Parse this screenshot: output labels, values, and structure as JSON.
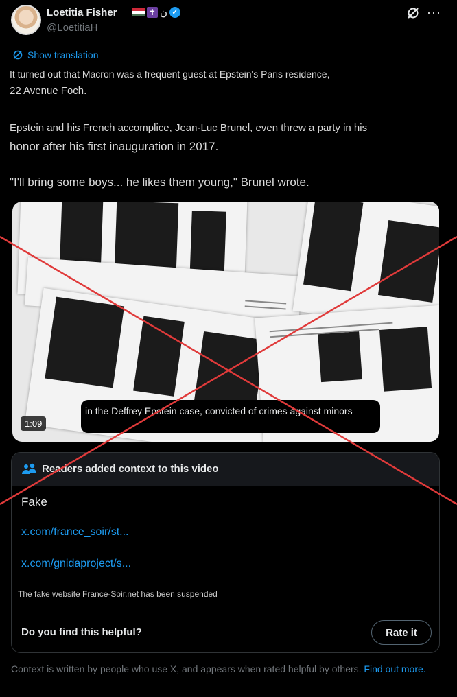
{
  "author": {
    "display_name": "Loetitia Fisher",
    "handle": "@LoetitiaH",
    "badge_text": "ن",
    "verified_mark": "✓",
    "cross_symbol": "✝"
  },
  "icons": {
    "grok": "grok-icon",
    "more": "more-icon",
    "translate": "translate-icon",
    "readers": "readers-icon"
  },
  "more_glyph": "···",
  "post": {
    "show_translation": "Show translation",
    "lines": [
      "It turned out that Macron was a frequent guest at Epstein's Paris residence,",
      "22 Avenue Foch.",
      "Epstein and his French accomplice, Jean-Luc Brunel, even threw a party in his",
      "honor after his first inauguration in 2017.",
      "\"I'll bring some boys... he likes them young,\" Brunel wrote."
    ]
  },
  "video": {
    "duration": "1:09",
    "caption": "in the Deffrey Epstein case, convicted of crimes against minors"
  },
  "community_note": {
    "title": "Readers added context to this video",
    "verdict": "Fake",
    "links": [
      "x.com/france_soir/st...",
      "x.com/gnidaproject/s..."
    ],
    "subtext": "The fake website France-Soir.net has been suspended",
    "helpful_question": "Do you find this helpful?",
    "rate_button": "Rate it"
  },
  "footer": {
    "text": "Context is written by people who use X, and appears when rated helpful by others.",
    "link_text": "Find out more."
  },
  "colors": {
    "background": "#000000",
    "accent": "#1d9bf0",
    "muted": "#71767b",
    "overlay_cross": "#e03a3a"
  }
}
